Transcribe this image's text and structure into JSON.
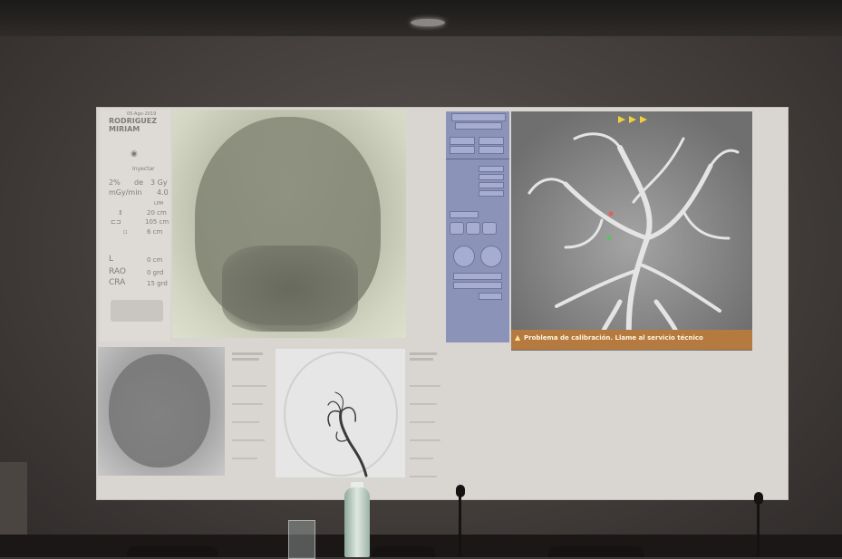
{
  "patient": {
    "surname": "RODRIGUEZ",
    "name": "MIRIAM",
    "date": "05-Ago-2019",
    "mode_label": "Inyectar",
    "dose_pct": "2%",
    "dose_of": "de",
    "dose_total": "3 Gy",
    "dose_rate_unit": "mGy/min",
    "dose_rate": "4.0",
    "fps": "LPM",
    "sid": "20 cm",
    "table_height": "105 cm",
    "table_offset": "6 cm",
    "pos_l_label": "L",
    "pos_l_value": "0 cm",
    "rao_label": "RAO",
    "rao_value": "0 grd",
    "cra_label": "CRA",
    "cra_value": "15 grd"
  },
  "warning": {
    "text": "Problema de calibración. Llame al servicio técnico"
  },
  "icons": {
    "warning": "warning-triangle-icon",
    "settings": "gear-icon"
  }
}
